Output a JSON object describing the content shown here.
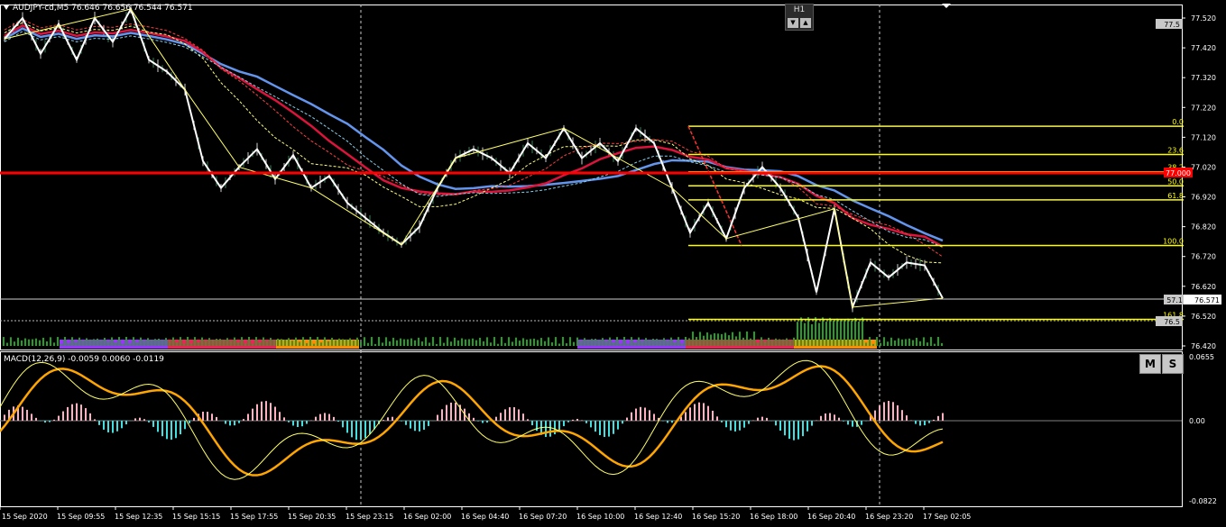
{
  "header": {
    "symbol_info": "AUDJPY-cd,M5  76.646 76.656 76.544 76.571",
    "timeframe": "H1",
    "tf_down": "▼",
    "tf_up": "▲"
  },
  "macd": {
    "label": "MACD(12,26,9) -0.0059 0.0060 -0.0119",
    "buttons": [
      "M",
      "S"
    ],
    "axis_labels": [
      "0.0655",
      "0.00",
      "-0.0822"
    ]
  },
  "price_axis": {
    "labels": [
      "77.520",
      "77.420",
      "77.320",
      "77.220",
      "77.120",
      "77.020",
      "76.920",
      "76.820",
      "76.720",
      "76.620",
      "76.520",
      "76.420"
    ],
    "tags": [
      "77.5",
      "57.1",
      "76.5"
    ],
    "current_price": "76.571",
    "red_line_tag": "77.000"
  },
  "time_axis": {
    "labels": [
      "15 Sep 2020",
      "15 Sep 09:55",
      "15 Sep 12:35",
      "15 Sep 15:15",
      "15 Sep 17:55",
      "15 Sep 20:35",
      "15 Sep 23:15",
      "16 Sep 02:00",
      "16 Sep 04:40",
      "16 Sep 07:20",
      "16 Sep 10:00",
      "16 Sep 12:40",
      "16 Sep 15:20",
      "16 Sep 18:00",
      "16 Sep 20:40",
      "16 Sep 23:20",
      "17 Sep 02:05"
    ]
  },
  "fibonacci": {
    "levels": [
      {
        "label": "0.0",
        "price": 77.157
      },
      {
        "label": "23.6",
        "price": 77.062
      },
      {
        "label": "38.2",
        "price": 77.004
      },
      {
        "label": "50.0",
        "price": 76.957
      },
      {
        "label": "61.8",
        "price": 76.91
      },
      {
        "label": "100.0",
        "price": 76.757
      },
      {
        "label": "161.8",
        "price": 76.509
      }
    ]
  },
  "colors": {
    "background": "#000000",
    "zigzag": "#ffffff",
    "fib": "#ffff00",
    "ma_red": "#dc143c",
    "ma_blue": "#6495ed",
    "ma_yellow": "#ffff80",
    "hline": "#ff0000",
    "volume": "#22a022",
    "macd_signal": "#ffa500",
    "macd_hist_pos": "#ffb0c0",
    "macd_hist_neg": "#40e0e0",
    "session_bars": [
      "#9933ff",
      "#ee2255",
      "#ff8c00"
    ]
  },
  "chart_data": {
    "type": "line",
    "series": [
      {
        "values": [
          77.45,
          77.52,
          77.4,
          77.5,
          77.38,
          77.52,
          77.44,
          77.55,
          77.38,
          77.34,
          77.28,
          77.04,
          76.95,
          77.02,
          77.08,
          76.98,
          77.06,
          76.95,
          76.99,
          76.9,
          76.85,
          76.8,
          76.76,
          76.82,
          76.95,
          77.05,
          77.08,
          77.05,
          77.0,
          77.1,
          77.05,
          77.15,
          77.05,
          77.1,
          77.04,
          77.15,
          77.1,
          76.95,
          76.8,
          76.9,
          76.78,
          76.95,
          77.02,
          76.95,
          76.85,
          76.6,
          76.88,
          76.55,
          76.7,
          76.65,
          76.7,
          76.69,
          76.58
        ]
      }
    ],
    "ylim": [
      76.4,
      77.57
    ]
  }
}
